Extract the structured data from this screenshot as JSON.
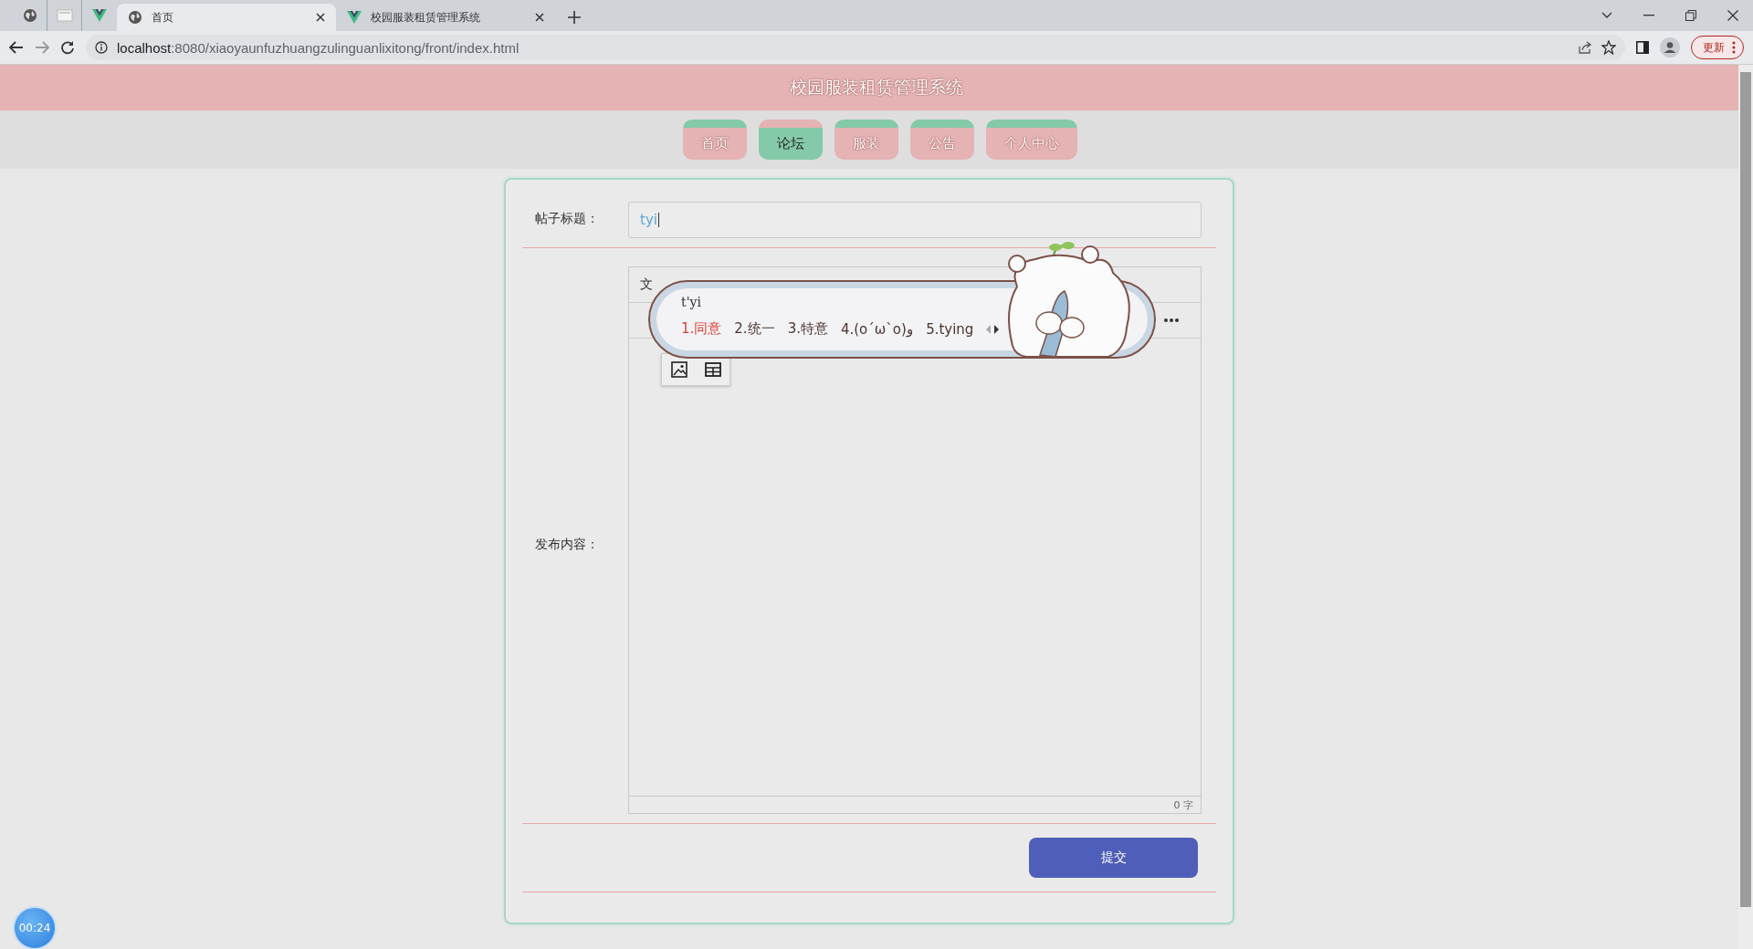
{
  "browser": {
    "tabs": [
      {
        "kind": "pinned"
      },
      {
        "kind": "pinned"
      },
      {
        "kind": "pinned"
      },
      {
        "kind": "tab",
        "title": "首页",
        "selected": true
      },
      {
        "kind": "tab",
        "title": "校园服装租赁管理系统",
        "selected": false
      }
    ],
    "address": {
      "host": "localhost",
      "path": ":8080/xiaoyaunfuzhuangzulinguanlixitong/front/index.html"
    },
    "update_button": "更新"
  },
  "header": {
    "title": "校园服装租赁管理系统"
  },
  "nav": [
    {
      "label": "首页",
      "selected": false
    },
    {
      "label": "论坛",
      "selected": true
    },
    {
      "label": "服装",
      "selected": false
    },
    {
      "label": "公告",
      "selected": false
    },
    {
      "label": "个人中心",
      "selected": false
    }
  ],
  "form": {
    "title_label": "帖子标题：",
    "title_value": "tyi",
    "content_label": "发布内容：",
    "editor_toolbar_text": "文",
    "counter": "0 字",
    "submit": "提交"
  },
  "ime": {
    "composition": "t'yi",
    "candidates": [
      {
        "label": "1.同意",
        "selected": true
      },
      {
        "label": "2.统一",
        "selected": false
      },
      {
        "label": "3.特意",
        "selected": false
      },
      {
        "label": "4.(o´ω`o)و",
        "selected": false
      },
      {
        "label": "5.tying",
        "selected": false
      }
    ]
  },
  "recorder": {
    "timer": "00:24"
  }
}
